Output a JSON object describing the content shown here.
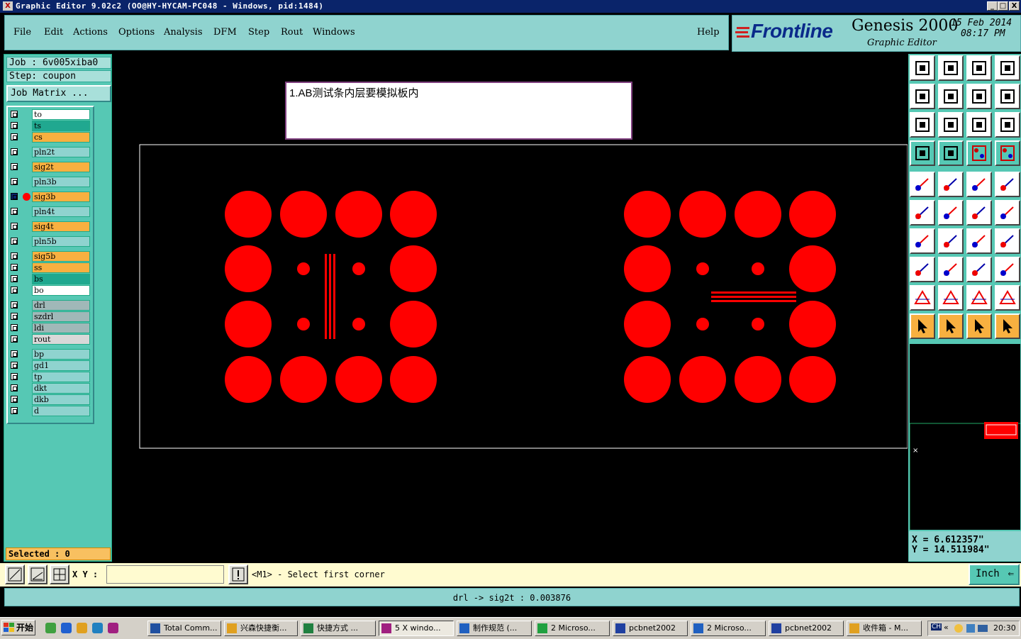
{
  "window": {
    "title": "Graphic Editor 9.02c2 (OO@HY-HYCAM-PC048 - Windows, pid:1484)",
    "btn_min": "_",
    "btn_max": "□",
    "btn_close": "X"
  },
  "menu": {
    "items": [
      "File",
      "Edit",
      "Actions",
      "Options",
      "Analysis",
      "DFM",
      "Step",
      "Rout",
      "Windows"
    ],
    "help": "Help"
  },
  "brand": {
    "logo": "Frontline",
    "product": "Genesis 2000",
    "subtitle": "Graphic Editor",
    "date": "15 Feb 2014",
    "time": "08:17 PM"
  },
  "job": {
    "job_line": "Job : 6v005xiba0",
    "step_line": "Step: coupon",
    "matrix_button": "Job Matrix ..."
  },
  "layers": [
    {
      "name": "to",
      "color": "#ffffff"
    },
    {
      "name": "ts",
      "color": "#20a890"
    },
    {
      "name": "cs",
      "color": "#f8b040"
    },
    {
      "name": "pln2t",
      "color": "#8fd3cf"
    },
    {
      "name": "sig2t",
      "color": "#f8b040"
    },
    {
      "name": "pln3b",
      "color": "#8fd3cf"
    },
    {
      "name": "sig3b",
      "color": "#f8b040",
      "active": true
    },
    {
      "name": "pln4t",
      "color": "#8fd3cf"
    },
    {
      "name": "sig4t",
      "color": "#f8b040"
    },
    {
      "name": "pln5b",
      "color": "#8fd3cf"
    },
    {
      "name": "sig5b",
      "color": "#f8b040"
    },
    {
      "name": "ss",
      "color": "#f8b040"
    },
    {
      "name": "bs",
      "color": "#20a890"
    },
    {
      "name": "bo",
      "color": "#ffffff"
    },
    {
      "name": "drl",
      "color": "#a0b8b8"
    },
    {
      "name": "szdrl",
      "color": "#a0b8b8"
    },
    {
      "name": "ldi",
      "color": "#a0b8b8"
    },
    {
      "name": "rout",
      "color": "#d8d8d8"
    },
    {
      "name": "bp",
      "color": "#8fd3cf"
    },
    {
      "name": "gd1",
      "color": "#8fd3cf"
    },
    {
      "name": "tp",
      "color": "#8fd3cf"
    },
    {
      "name": "dkt",
      "color": "#8fd3cf"
    },
    {
      "name": "dkb",
      "color": "#8fd3cf"
    },
    {
      "name": "d",
      "color": "#8fd3cf"
    }
  ],
  "selected": "Selected : 0",
  "note": "1.AB测试条内层要模拟板内",
  "coords": {
    "x": "X = 6.612357\"",
    "y": "Y = 14.511984\""
  },
  "cmdbar": {
    "xy_label": "X Y :",
    "xy_value": "",
    "prompt": "<M1> - Select first corner",
    "unit": "Inch"
  },
  "status": "drl -> sig2t : 0.003876",
  "colors": {
    "feature": "#ff0000",
    "panel": "#56c8b4",
    "menubar": "#8fd3cf"
  },
  "taskbar": {
    "start": "开始",
    "tasks": [
      "Total Comm...",
      "兴森快捷衡...",
      "快捷方式 ...",
      "5 X windo...",
      "制作规范 (...",
      "2 Microso...",
      "pcbnet2002",
      "2 Microso...",
      "pcbnet2002",
      "收件箱 - M..."
    ],
    "tray_lang": "CH",
    "tray_time": "20:30"
  }
}
